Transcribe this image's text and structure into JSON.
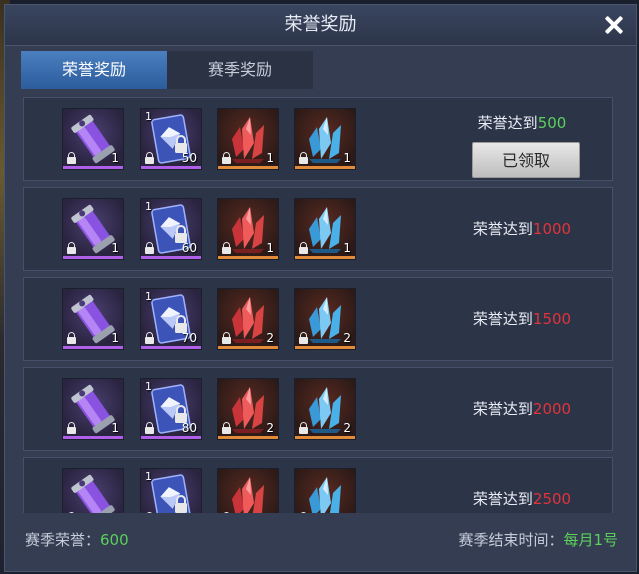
{
  "title": "荣誉奖励",
  "tabs": [
    {
      "label": "荣誉奖励",
      "active": true
    },
    {
      "label": "赛季奖励",
      "active": false
    }
  ],
  "rewards": [
    {
      "requirement_label": "荣誉达到",
      "requirement_value": "500",
      "value_color": "green",
      "claimed": true,
      "claimed_label": "已领取",
      "items": [
        {
          "icon": "purple-capsule",
          "qty": "1"
        },
        {
          "icon": "blue-card",
          "qty": "50",
          "top": "1"
        },
        {
          "icon": "red-crystal",
          "qty": "1"
        },
        {
          "icon": "blue-crystal",
          "qty": "1"
        }
      ]
    },
    {
      "requirement_label": "荣誉达到",
      "requirement_value": "1000",
      "value_color": "red",
      "claimed": false,
      "items": [
        {
          "icon": "purple-capsule",
          "qty": "1"
        },
        {
          "icon": "blue-card",
          "qty": "60",
          "top": "1"
        },
        {
          "icon": "red-crystal",
          "qty": "1"
        },
        {
          "icon": "blue-crystal",
          "qty": "1"
        }
      ]
    },
    {
      "requirement_label": "荣誉达到",
      "requirement_value": "1500",
      "value_color": "red",
      "claimed": false,
      "items": [
        {
          "icon": "purple-capsule",
          "qty": "1"
        },
        {
          "icon": "blue-card",
          "qty": "70",
          "top": "1"
        },
        {
          "icon": "red-crystal",
          "qty": "2"
        },
        {
          "icon": "blue-crystal",
          "qty": "2"
        }
      ]
    },
    {
      "requirement_label": "荣誉达到",
      "requirement_value": "2000",
      "value_color": "red",
      "claimed": false,
      "items": [
        {
          "icon": "purple-capsule",
          "qty": "1"
        },
        {
          "icon": "blue-card",
          "qty": "80",
          "top": "1"
        },
        {
          "icon": "red-crystal",
          "qty": "2"
        },
        {
          "icon": "blue-crystal",
          "qty": "2"
        }
      ]
    },
    {
      "requirement_label": "荣誉达到",
      "requirement_value": "2500",
      "value_color": "red",
      "claimed": false,
      "items": [
        {
          "icon": "purple-capsule",
          "qty": ""
        },
        {
          "icon": "blue-card",
          "qty": "",
          "top": "1"
        },
        {
          "icon": "red-crystal",
          "qty": ""
        },
        {
          "icon": "blue-crystal",
          "qty": ""
        }
      ]
    }
  ],
  "footer": {
    "season_honor_label": "赛季荣誉：",
    "season_honor_value": "600",
    "season_end_label": "赛季结束时间：",
    "season_end_value": "每月1号"
  },
  "colors": {
    "green": "#5bd15b",
    "red": "#e2333a",
    "active_tab": "#3a6fb0",
    "purple_rarity": "#b060e8",
    "orange_rarity": "#e08a3a"
  }
}
